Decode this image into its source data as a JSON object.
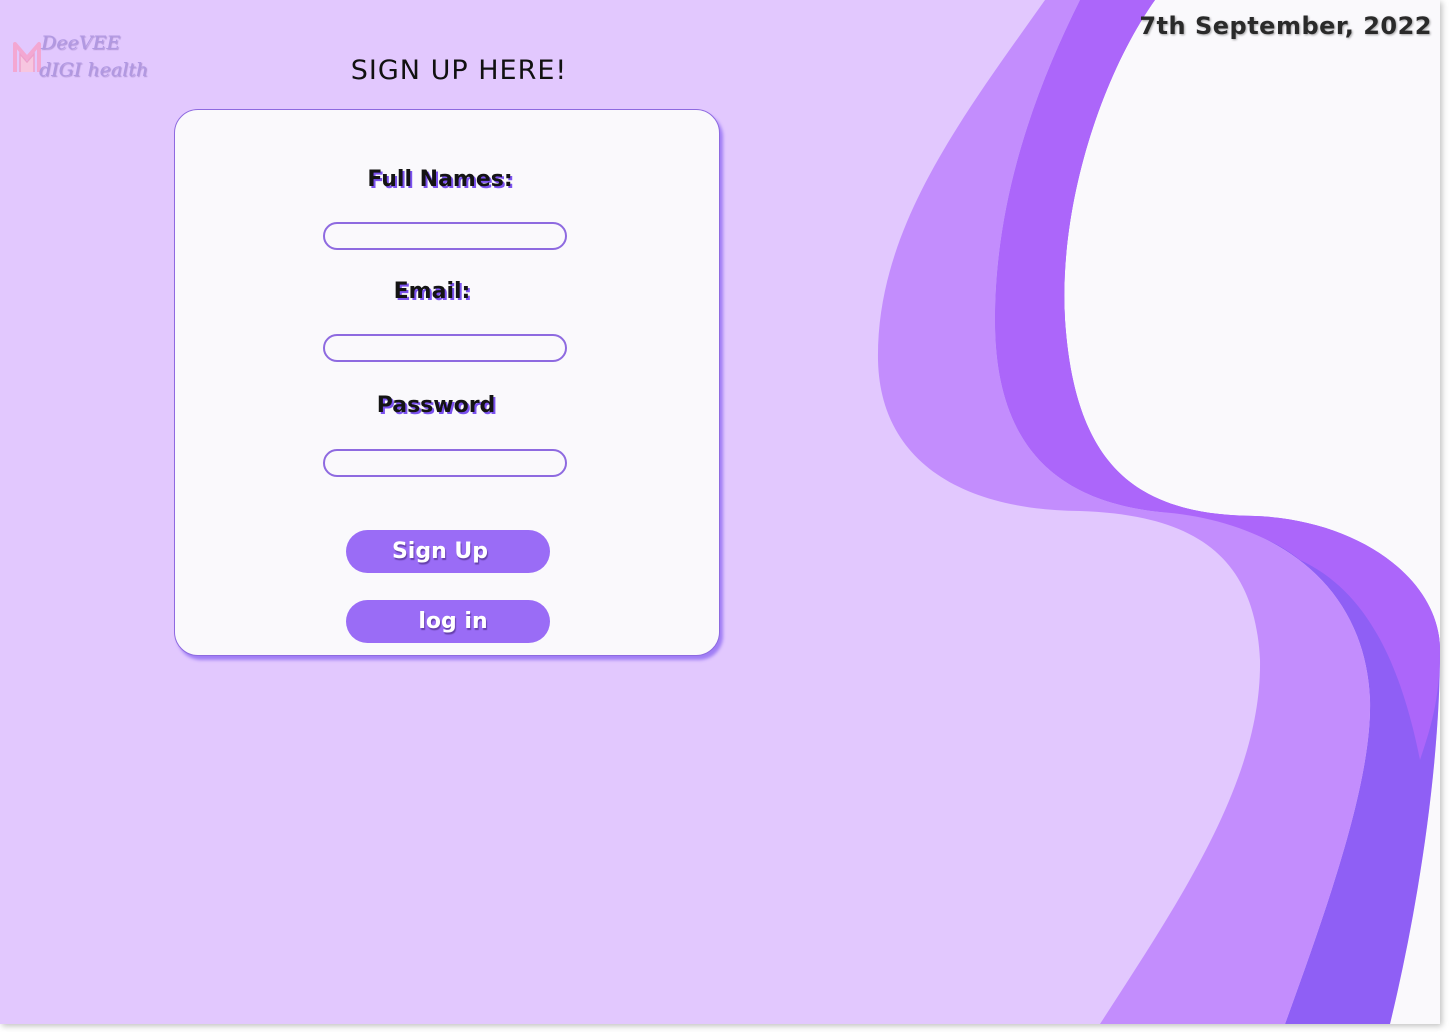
{
  "header": {
    "logo_line1": "DeeVEE",
    "logo_line2": "dIGI health",
    "date": "7th September, 2022"
  },
  "form": {
    "title": "SIGN UP HERE!",
    "fields": [
      {
        "label": "Full Names:",
        "value": "",
        "type": "text"
      },
      {
        "label": "Email:",
        "value": "",
        "type": "email"
      },
      {
        "label": "Password",
        "value": "",
        "type": "password"
      }
    ],
    "signup_label": "Sign Up",
    "login_label": "log in"
  },
  "colors": {
    "background": "#e2c8fe",
    "accent": "#9a6cf6",
    "wave_light": "#c38dfd",
    "wave_mid": "#ac66fa",
    "wave_dark": "#8f5ff5",
    "card": "#faf9fc"
  }
}
